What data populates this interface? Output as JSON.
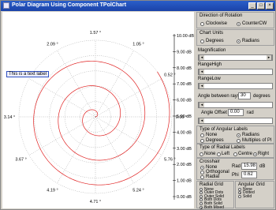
{
  "window": {
    "title": "Polar Diagram Using Component  TPolChart"
  },
  "chart": {
    "text_label": "This is a text label",
    "angle_labels": [
      "1.57 °",
      "1.05 °",
      "0.52 °",
      "0.00 °",
      "5.76 °",
      "5.24 °",
      "4.71 °",
      "4.19 °",
      "3.67 °",
      "3.14 °",
      "2.62 °",
      "2.09 °"
    ],
    "radial_ticks": [
      "10.00 dB",
      "9.00 dB",
      "8.00 dB",
      "7.00 dB",
      "6.00 dB",
      "5.00 dB",
      "4.00 dB",
      "3.00 dB",
      "2.00 dB",
      "1.00 dB",
      "0.00 dB"
    ],
    "spiral_color": "#e02020"
  },
  "panel": {
    "rotation": {
      "title": "Direction of Rotation",
      "opt1": "Clockwise",
      "opt2": "CounterCW"
    },
    "units": {
      "title": "Chart Units",
      "opt1": "Degrees",
      "opt2": "Radians"
    },
    "magnification": "Magnification",
    "range_high": "RangeHigh",
    "range_low": "RangeLow",
    "angle_between_rays": {
      "label": "Angle between rays",
      "value": "30",
      "unit": "degrees"
    },
    "angle_offset": {
      "label": "Angle Offset",
      "value": "0.00",
      "unit": "rad"
    },
    "angular_labels": {
      "title": "Type of Angular Labels",
      "opt1": "None",
      "opt2": "Radians",
      "opt3": "Degrees",
      "opt4": "Multiples of PI"
    },
    "radial_labels": {
      "title": "Type of Radial Labels",
      "opt1": "None",
      "opt2": "Left",
      "opt3": "Centre",
      "opt4": "Right"
    },
    "crosshair": {
      "title": "Crosshair",
      "opt1": "None",
      "opt2": "Orthogonal",
      "opt3": "Radial",
      "rad_label": "Rad",
      "rad_value": "15.98",
      "rad_unit": "dB",
      "phi_label": "Phi",
      "phi_value": "0.62"
    },
    "radial_grid": {
      "title": "Radial Grid",
      "items": [
        "None",
        "Outer Dots",
        "Outer Solid",
        "Both Dots",
        "Both Solid",
        "Both Mixed"
      ]
    },
    "angular_grid": {
      "title": "Angular Grid",
      "items": [
        "None",
        "Dotted",
        "Solid"
      ]
    }
  }
}
